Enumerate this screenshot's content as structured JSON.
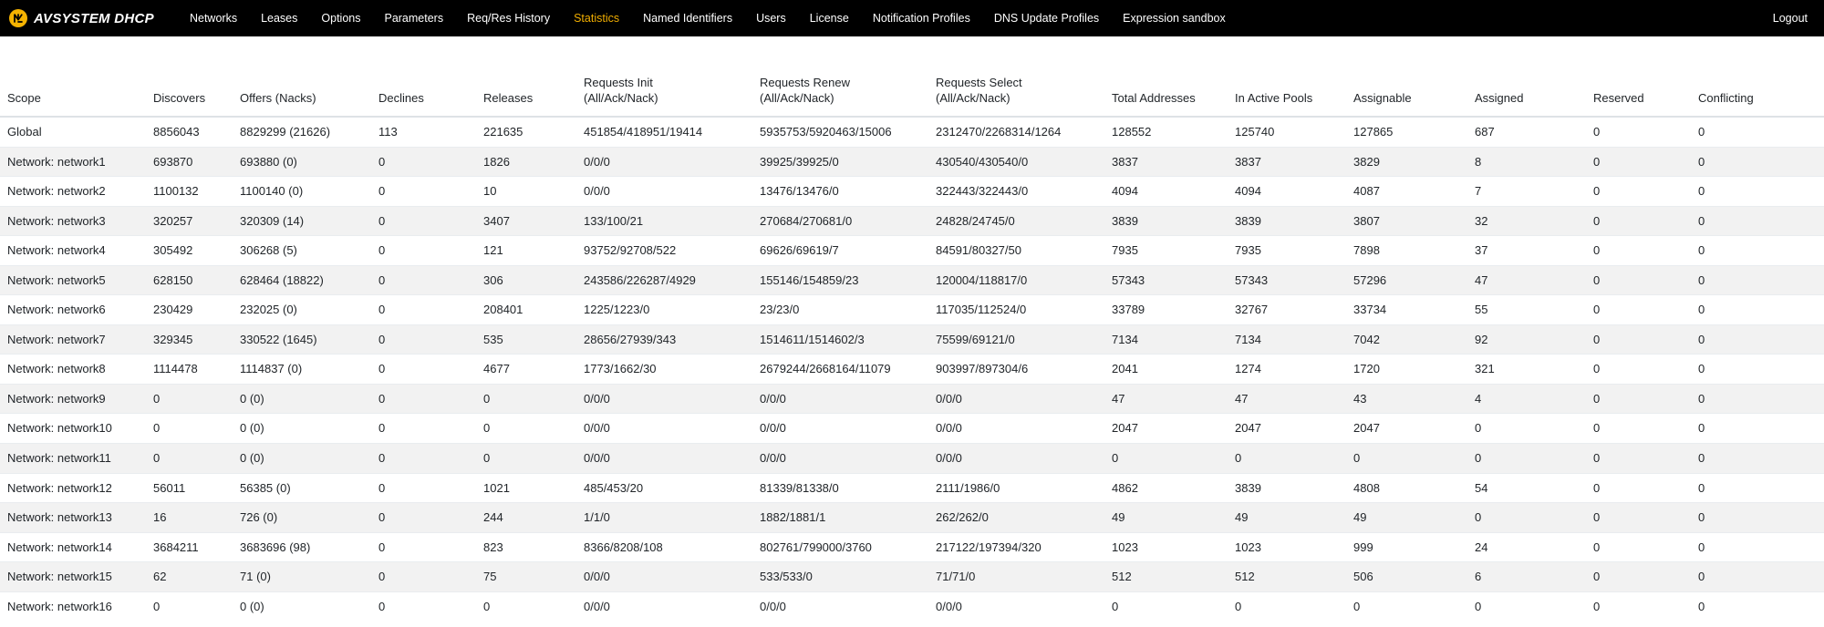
{
  "brand": {
    "logo_icon": "avsystem-logo-icon",
    "text": "AVSYSTEM DHCP"
  },
  "nav": {
    "items": [
      {
        "label": "Networks",
        "active": false
      },
      {
        "label": "Leases",
        "active": false
      },
      {
        "label": "Options",
        "active": false
      },
      {
        "label": "Parameters",
        "active": false
      },
      {
        "label": "Req/Res History",
        "active": false
      },
      {
        "label": "Statistics",
        "active": true
      },
      {
        "label": "Named Identifiers",
        "active": false
      },
      {
        "label": "Users",
        "active": false
      },
      {
        "label": "License",
        "active": false
      },
      {
        "label": "Notification Profiles",
        "active": false
      },
      {
        "label": "DNS Update Profiles",
        "active": false
      },
      {
        "label": "Expression sandbox",
        "active": false
      }
    ],
    "logout_label": "Logout",
    "active_color": "#f0ad00",
    "background_color": "#000000"
  },
  "table": {
    "columns": [
      {
        "line1": "Scope",
        "line2": ""
      },
      {
        "line1": "Discovers",
        "line2": ""
      },
      {
        "line1": "Offers (Nacks)",
        "line2": ""
      },
      {
        "line1": "Declines",
        "line2": ""
      },
      {
        "line1": "Releases",
        "line2": ""
      },
      {
        "line1": "Requests Init",
        "line2": "(All/Ack/Nack)"
      },
      {
        "line1": "Requests Renew",
        "line2": "(All/Ack/Nack)"
      },
      {
        "line1": "Requests Select",
        "line2": "(All/Ack/Nack)"
      },
      {
        "line1": "Total Addresses",
        "line2": ""
      },
      {
        "line1": "In Active Pools",
        "line2": ""
      },
      {
        "line1": "Assignable",
        "line2": ""
      },
      {
        "line1": "Assigned",
        "line2": ""
      },
      {
        "line1": "Reserved",
        "line2": ""
      },
      {
        "line1": "Conflicting",
        "line2": ""
      }
    ],
    "rows": [
      [
        "Global",
        "8856043",
        "8829299 (21626)",
        "113",
        "221635",
        "451854/418951/19414",
        "5935753/5920463/15006",
        "2312470/2268314/1264",
        "128552",
        "125740",
        "127865",
        "687",
        "0",
        "0"
      ],
      [
        "Network: network1",
        "693870",
        "693880 (0)",
        "0",
        "1826",
        "0/0/0",
        "39925/39925/0",
        "430540/430540/0",
        "3837",
        "3837",
        "3829",
        "8",
        "0",
        "0"
      ],
      [
        "Network: network2",
        "1100132",
        "1100140 (0)",
        "0",
        "10",
        "0/0/0",
        "13476/13476/0",
        "322443/322443/0",
        "4094",
        "4094",
        "4087",
        "7",
        "0",
        "0"
      ],
      [
        "Network: network3",
        "320257",
        "320309 (14)",
        "0",
        "3407",
        "133/100/21",
        "270684/270681/0",
        "24828/24745/0",
        "3839",
        "3839",
        "3807",
        "32",
        "0",
        "0"
      ],
      [
        "Network: network4",
        "305492",
        "306268 (5)",
        "0",
        "121",
        "93752/92708/522",
        "69626/69619/7",
        "84591/80327/50",
        "7935",
        "7935",
        "7898",
        "37",
        "0",
        "0"
      ],
      [
        "Network: network5",
        "628150",
        "628464 (18822)",
        "0",
        "306",
        "243586/226287/4929",
        "155146/154859/23",
        "120004/118817/0",
        "57343",
        "57343",
        "57296",
        "47",
        "0",
        "0"
      ],
      [
        "Network: network6",
        "230429",
        "232025 (0)",
        "0",
        "208401",
        "1225/1223/0",
        "23/23/0",
        "117035/112524/0",
        "33789",
        "32767",
        "33734",
        "55",
        "0",
        "0"
      ],
      [
        "Network: network7",
        "329345",
        "330522 (1645)",
        "0",
        "535",
        "28656/27939/343",
        "1514611/1514602/3",
        "75599/69121/0",
        "7134",
        "7134",
        "7042",
        "92",
        "0",
        "0"
      ],
      [
        "Network: network8",
        "1114478",
        "1114837 (0)",
        "0",
        "4677",
        "1773/1662/30",
        "2679244/2668164/11079",
        "903997/897304/6",
        "2041",
        "1274",
        "1720",
        "321",
        "0",
        "0"
      ],
      [
        "Network: network9",
        "0",
        "0 (0)",
        "0",
        "0",
        "0/0/0",
        "0/0/0",
        "0/0/0",
        "47",
        "47",
        "43",
        "4",
        "0",
        "0"
      ],
      [
        "Network: network10",
        "0",
        "0 (0)",
        "0",
        "0",
        "0/0/0",
        "0/0/0",
        "0/0/0",
        "2047",
        "2047",
        "2047",
        "0",
        "0",
        "0"
      ],
      [
        "Network: network11",
        "0",
        "0 (0)",
        "0",
        "0",
        "0/0/0",
        "0/0/0",
        "0/0/0",
        "0",
        "0",
        "0",
        "0",
        "0",
        "0"
      ],
      [
        "Network: network12",
        "56011",
        "56385 (0)",
        "0",
        "1021",
        "485/453/20",
        "81339/81338/0",
        "2111/1986/0",
        "4862",
        "3839",
        "4808",
        "54",
        "0",
        "0"
      ],
      [
        "Network: network13",
        "16",
        "726 (0)",
        "0",
        "244",
        "1/1/0",
        "1882/1881/1",
        "262/262/0",
        "49",
        "49",
        "49",
        "0",
        "0",
        "0"
      ],
      [
        "Network: network14",
        "3684211",
        "3683696 (98)",
        "0",
        "823",
        "8366/8208/108",
        "802761/799000/3760",
        "217122/197394/320",
        "1023",
        "1023",
        "999",
        "24",
        "0",
        "0"
      ],
      [
        "Network: network15",
        "62",
        "71 (0)",
        "0",
        "75",
        "0/0/0",
        "533/533/0",
        "71/71/0",
        "512",
        "512",
        "506",
        "6",
        "0",
        "0"
      ],
      [
        "Network: network16",
        "0",
        "0 (0)",
        "0",
        "0",
        "0/0/0",
        "0/0/0",
        "0/0/0",
        "0",
        "0",
        "0",
        "0",
        "0",
        "0"
      ]
    ]
  }
}
